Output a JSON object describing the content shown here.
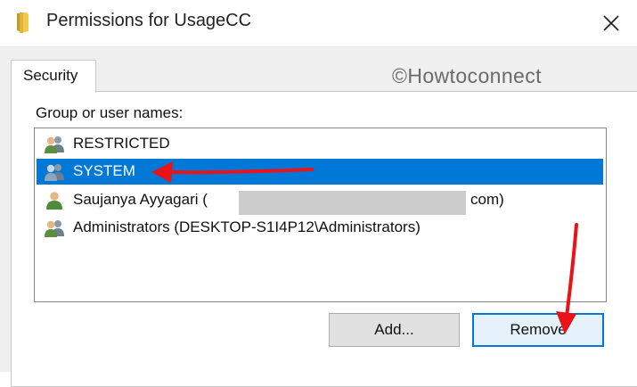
{
  "window": {
    "title": "Permissions for UsageCC",
    "title_icon": "folder-icon",
    "close_icon": "close-icon"
  },
  "tabs": [
    {
      "label": "Security",
      "selected": true
    }
  ],
  "watermark": "©Howtoconnect",
  "group_label": "Group or user names:",
  "users": [
    {
      "name": "RESTRICTED",
      "icon": "user-group-icon",
      "selected": false
    },
    {
      "name": "SYSTEM",
      "icon": "user-group-icon",
      "selected": true
    },
    {
      "name_start": "Saujanya Ayyagari (",
      "name_end": "com)",
      "icon": "user-icon",
      "selected": false
    },
    {
      "name": "Administrators (DESKTOP-S1I4P12\\Administrators)",
      "icon": "user-group-icon",
      "selected": false
    }
  ],
  "buttons": {
    "add": "Add...",
    "remove": "Remove"
  },
  "colors": {
    "selection": "#0078d7",
    "arrow": "#e8141a",
    "title_bg": "#ffffff",
    "dialog_bg": "#f0f0f0"
  }
}
